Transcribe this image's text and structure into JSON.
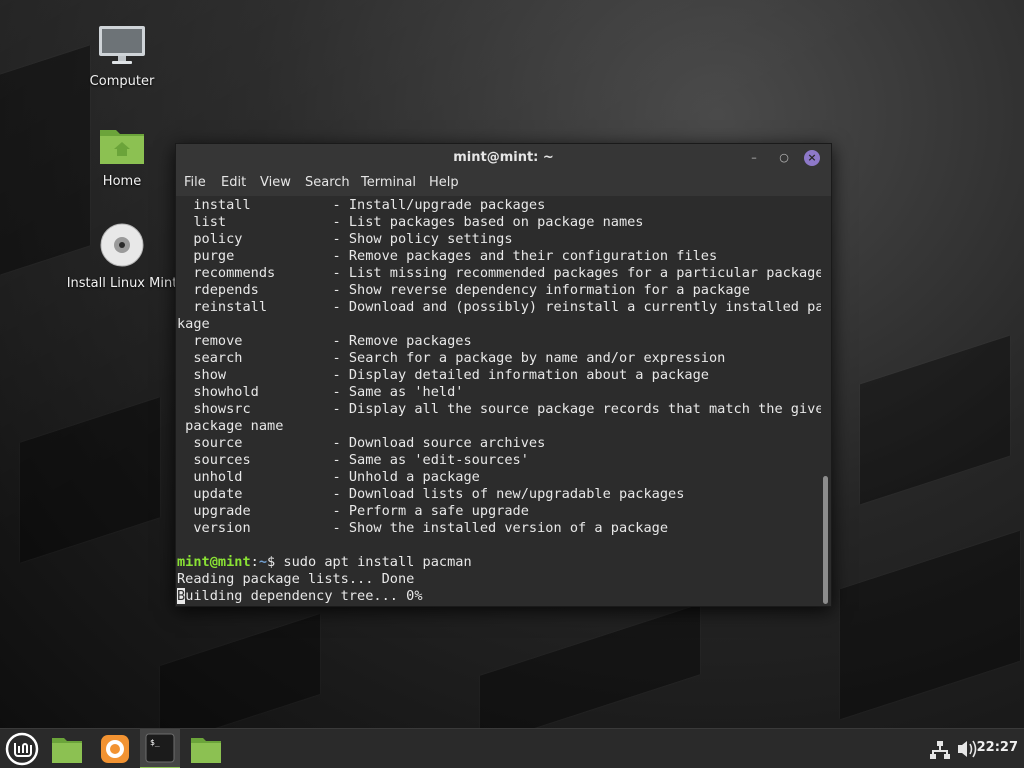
{
  "desktop": {
    "icons": [
      {
        "label": "Computer",
        "icon": "computer-icon"
      },
      {
        "label": "Home",
        "icon": "home-folder-icon"
      },
      {
        "label": "Install Linux Mint",
        "icon": "disc-icon"
      }
    ]
  },
  "window": {
    "title": "mint@mint: ~",
    "menu": [
      "File",
      "Edit",
      "View",
      "Search",
      "Terminal",
      "Help"
    ],
    "controls": {
      "minimize": "minimize-icon",
      "maximize": "maximize-icon",
      "close": "close-icon"
    }
  },
  "terminal": {
    "lines": [
      "  install          - Install/upgrade packages",
      "  list             - List packages based on package names",
      "  policy           - Show policy settings",
      "  purge            - Remove packages and their configuration files",
      "  recommends       - List missing recommended packages for a particular package",
      "  rdepends         - Show reverse dependency information for a package",
      "  reinstall        - Download and (possibly) reinstall a currently installed pac",
      "kage",
      "  remove           - Remove packages",
      "  search           - Search for a package by name and/or expression",
      "  show             - Display detailed information about a package",
      "  showhold         - Same as 'held'",
      "  showsrc          - Display all the source package records that match the given",
      " package name",
      "  source           - Download source archives",
      "  sources          - Same as 'edit-sources'",
      "  unhold           - Unhold a package",
      "  update           - Download lists of new/upgradable packages",
      "  upgrade          - Perform a safe upgrade",
      "  version          - Show the installed version of a package",
      ""
    ],
    "prompt_user": "mint@mint",
    "prompt_sep": ":",
    "prompt_path": "~",
    "prompt_command": "$ sudo apt install pacman",
    "output1": "Reading package lists... Done",
    "output2_cursor": "B",
    "output2_rest": "uilding dependency tree... 0%"
  },
  "taskbar": {
    "items": [
      "mint-menu-icon",
      "show-desktop-icon",
      "firefox-icon",
      "terminal-icon",
      "files-icon"
    ],
    "tray": [
      "network-icon",
      "volume-icon"
    ],
    "clock": "22:27"
  }
}
